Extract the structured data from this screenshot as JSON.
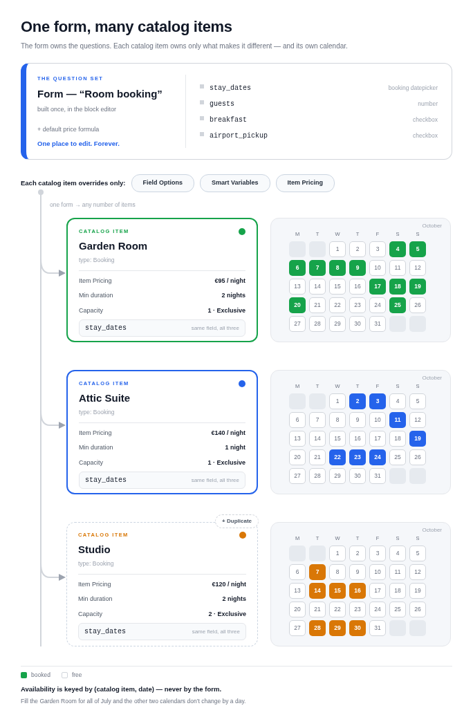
{
  "header": {
    "title": "One form, many catalog items",
    "subtitle": "The form owns the questions. Each catalog item owns only what makes it different — and its own calendar."
  },
  "question_set": {
    "eyebrow": "THE QUESTION SET",
    "title": "Form — “Room booking”",
    "note": "built once, in the block editor",
    "extra": "+ default price formula",
    "tagline": "One place to edit. Forever.",
    "fields": [
      {
        "name": "stay_dates",
        "type": "booking datepicker"
      },
      {
        "name": "guests",
        "type": "number"
      },
      {
        "name": "breakfast",
        "type": "checkbox"
      },
      {
        "name": "airport_pickup",
        "type": "checkbox"
      }
    ]
  },
  "overrides": {
    "label": "Each catalog item overrides only:",
    "chips": [
      "Field Options",
      "Smart Variables",
      "Item Pricing"
    ]
  },
  "flow_label": "one form → any number of items",
  "items": [
    {
      "eyebrow": "CATALOG ITEM",
      "name": "Garden Room",
      "type": "type: Booking",
      "color": "#16a34a",
      "draft": false,
      "properties": [
        {
          "label": "Item Pricing",
          "value": "€95 / night"
        },
        {
          "label": "Min duration",
          "value": "2 nights"
        },
        {
          "label": "Capacity",
          "value": "1 · Exclusive"
        }
      ],
      "field": {
        "name": "stay_dates",
        "note": "same field, all three"
      },
      "calendar": {
        "month": "October",
        "weekdays": [
          "M",
          "T",
          "W",
          "T",
          "F",
          "S",
          "S"
        ],
        "days": [
          {
            "kind": "blank"
          },
          {
            "kind": "blank"
          },
          {
            "kind": "day",
            "day": "1",
            "booked": false
          },
          {
            "kind": "day",
            "day": "2",
            "booked": false
          },
          {
            "kind": "day",
            "day": "3",
            "booked": false
          },
          {
            "kind": "day",
            "day": "4",
            "booked": true
          },
          {
            "kind": "day",
            "day": "5",
            "booked": true
          },
          {
            "kind": "day",
            "day": "6",
            "booked": true
          },
          {
            "kind": "day",
            "day": "7",
            "booked": true
          },
          {
            "kind": "day",
            "day": "8",
            "booked": true
          },
          {
            "kind": "day",
            "day": "9",
            "booked": true
          },
          {
            "kind": "day",
            "day": "10",
            "booked": false
          },
          {
            "kind": "day",
            "day": "11",
            "booked": false
          },
          {
            "kind": "day",
            "day": "12",
            "booked": false
          },
          {
            "kind": "day",
            "day": "13",
            "booked": false
          },
          {
            "kind": "day",
            "day": "14",
            "booked": false
          },
          {
            "kind": "day",
            "day": "15",
            "booked": false
          },
          {
            "kind": "day",
            "day": "16",
            "booked": false
          },
          {
            "kind": "day",
            "day": "17",
            "booked": true
          },
          {
            "kind": "day",
            "day": "18",
            "booked": true
          },
          {
            "kind": "day",
            "day": "19",
            "booked": true
          },
          {
            "kind": "day",
            "day": "20",
            "booked": true
          },
          {
            "kind": "day",
            "day": "21",
            "booked": false
          },
          {
            "kind": "day",
            "day": "22",
            "booked": false
          },
          {
            "kind": "day",
            "day": "23",
            "booked": false
          },
          {
            "kind": "day",
            "day": "24",
            "booked": false
          },
          {
            "kind": "day",
            "day": "25",
            "booked": true
          },
          {
            "kind": "day",
            "day": "26",
            "booked": false
          },
          {
            "kind": "day",
            "day": "27",
            "booked": false
          },
          {
            "kind": "day",
            "day": "28",
            "booked": false
          },
          {
            "kind": "day",
            "day": "29",
            "booked": false
          },
          {
            "kind": "day",
            "day": "30",
            "booked": false
          },
          {
            "kind": "day",
            "day": "31",
            "booked": false
          },
          {
            "kind": "blank"
          },
          {
            "kind": "blank"
          }
        ]
      }
    },
    {
      "eyebrow": "CATALOG ITEM",
      "name": "Attic Suite",
      "type": "type: Booking",
      "color": "#2563eb",
      "draft": false,
      "properties": [
        {
          "label": "Item Pricing",
          "value": "€140 / night"
        },
        {
          "label": "Min duration",
          "value": "1 night"
        },
        {
          "label": "Capacity",
          "value": "1 · Exclusive"
        }
      ],
      "field": {
        "name": "stay_dates",
        "note": "same field, all three"
      },
      "calendar": {
        "month": "October",
        "weekdays": [
          "M",
          "T",
          "W",
          "T",
          "F",
          "S",
          "S"
        ],
        "days": [
          {
            "kind": "blank"
          },
          {
            "kind": "blank"
          },
          {
            "kind": "day",
            "day": "1",
            "booked": false
          },
          {
            "kind": "day",
            "day": "2",
            "booked": true
          },
          {
            "kind": "day",
            "day": "3",
            "booked": true
          },
          {
            "kind": "day",
            "day": "4",
            "booked": false
          },
          {
            "kind": "day",
            "day": "5",
            "booked": false
          },
          {
            "kind": "day",
            "day": "6",
            "booked": false
          },
          {
            "kind": "day",
            "day": "7",
            "booked": false
          },
          {
            "kind": "day",
            "day": "8",
            "booked": false
          },
          {
            "kind": "day",
            "day": "9",
            "booked": false
          },
          {
            "kind": "day",
            "day": "10",
            "booked": false
          },
          {
            "kind": "day",
            "day": "11",
            "booked": true
          },
          {
            "kind": "day",
            "day": "12",
            "booked": false
          },
          {
            "kind": "day",
            "day": "13",
            "booked": false
          },
          {
            "kind": "day",
            "day": "14",
            "booked": false
          },
          {
            "kind": "day",
            "day": "15",
            "booked": false
          },
          {
            "kind": "day",
            "day": "16",
            "booked": false
          },
          {
            "kind": "day",
            "day": "17",
            "booked": false
          },
          {
            "kind": "day",
            "day": "18",
            "booked": false
          },
          {
            "kind": "day",
            "day": "19",
            "booked": true
          },
          {
            "kind": "day",
            "day": "20",
            "booked": false
          },
          {
            "kind": "day",
            "day": "21",
            "booked": false
          },
          {
            "kind": "day",
            "day": "22",
            "booked": true
          },
          {
            "kind": "day",
            "day": "23",
            "booked": true
          },
          {
            "kind": "day",
            "day": "24",
            "booked": true
          },
          {
            "kind": "day",
            "day": "25",
            "booked": false
          },
          {
            "kind": "day",
            "day": "26",
            "booked": false
          },
          {
            "kind": "day",
            "day": "27",
            "booked": false
          },
          {
            "kind": "day",
            "day": "28",
            "booked": false
          },
          {
            "kind": "day",
            "day": "29",
            "booked": false
          },
          {
            "kind": "day",
            "day": "30",
            "booked": false
          },
          {
            "kind": "day",
            "day": "31",
            "booked": false
          },
          {
            "kind": "blank"
          },
          {
            "kind": "blank"
          }
        ]
      }
    },
    {
      "eyebrow": "CATALOG ITEM",
      "name": "Studio",
      "type": "type: Booking",
      "color": "#d97706",
      "draft": true,
      "duplicate": "+ Duplicate",
      "properties": [
        {
          "label": "Item Pricing",
          "value": "€120 / night"
        },
        {
          "label": "Min duration",
          "value": "2 nights"
        },
        {
          "label": "Capacity",
          "value": "2 · Exclusive"
        }
      ],
      "field": {
        "name": "stay_dates",
        "note": "same field, all three"
      },
      "calendar": {
        "month": "October",
        "weekdays": [
          "M",
          "T",
          "W",
          "T",
          "F",
          "S",
          "S"
        ],
        "days": [
          {
            "kind": "blank"
          },
          {
            "kind": "blank"
          },
          {
            "kind": "day",
            "day": "1",
            "booked": false
          },
          {
            "kind": "day",
            "day": "2",
            "booked": false
          },
          {
            "kind": "day",
            "day": "3",
            "booked": false
          },
          {
            "kind": "day",
            "day": "4",
            "booked": false
          },
          {
            "kind": "day",
            "day": "5",
            "booked": false
          },
          {
            "kind": "day",
            "day": "6",
            "booked": false
          },
          {
            "kind": "day",
            "day": "7",
            "booked": true
          },
          {
            "kind": "day",
            "day": "8",
            "booked": false
          },
          {
            "kind": "day",
            "day": "9",
            "booked": false
          },
          {
            "kind": "day",
            "day": "10",
            "booked": false
          },
          {
            "kind": "day",
            "day": "11",
            "booked": false
          },
          {
            "kind": "day",
            "day": "12",
            "booked": false
          },
          {
            "kind": "day",
            "day": "13",
            "booked": false
          },
          {
            "kind": "day",
            "day": "14",
            "booked": true
          },
          {
            "kind": "day",
            "day": "15",
            "booked": true
          },
          {
            "kind": "day",
            "day": "16",
            "booked": true
          },
          {
            "kind": "day",
            "day": "17",
            "booked": false
          },
          {
            "kind": "day",
            "day": "18",
            "booked": false
          },
          {
            "kind": "day",
            "day": "19",
            "booked": false
          },
          {
            "kind": "day",
            "day": "20",
            "booked": false
          },
          {
            "kind": "day",
            "day": "21",
            "booked": false
          },
          {
            "kind": "day",
            "day": "22",
            "booked": false
          },
          {
            "kind": "day",
            "day": "23",
            "booked": false
          },
          {
            "kind": "day",
            "day": "24",
            "booked": false
          },
          {
            "kind": "day",
            "day": "25",
            "booked": false
          },
          {
            "kind": "day",
            "day": "26",
            "booked": false
          },
          {
            "kind": "day",
            "day": "27",
            "booked": false
          },
          {
            "kind": "day",
            "day": "28",
            "booked": true
          },
          {
            "kind": "day",
            "day": "29",
            "booked": true
          },
          {
            "kind": "day",
            "day": "30",
            "booked": true
          },
          {
            "kind": "day",
            "day": "31",
            "booked": false
          },
          {
            "kind": "blank"
          },
          {
            "kind": "blank"
          }
        ]
      }
    }
  ],
  "legend": [
    {
      "kind": "booked",
      "label": "booked",
      "color": "#16a34a"
    },
    {
      "kind": "free",
      "label": "free"
    }
  ],
  "footer": {
    "statement": "Availability is keyed by (catalog item, date) — never by the form.",
    "note": "Fill the Garden Room for all of July and the other two calendars don’t change by a day."
  }
}
